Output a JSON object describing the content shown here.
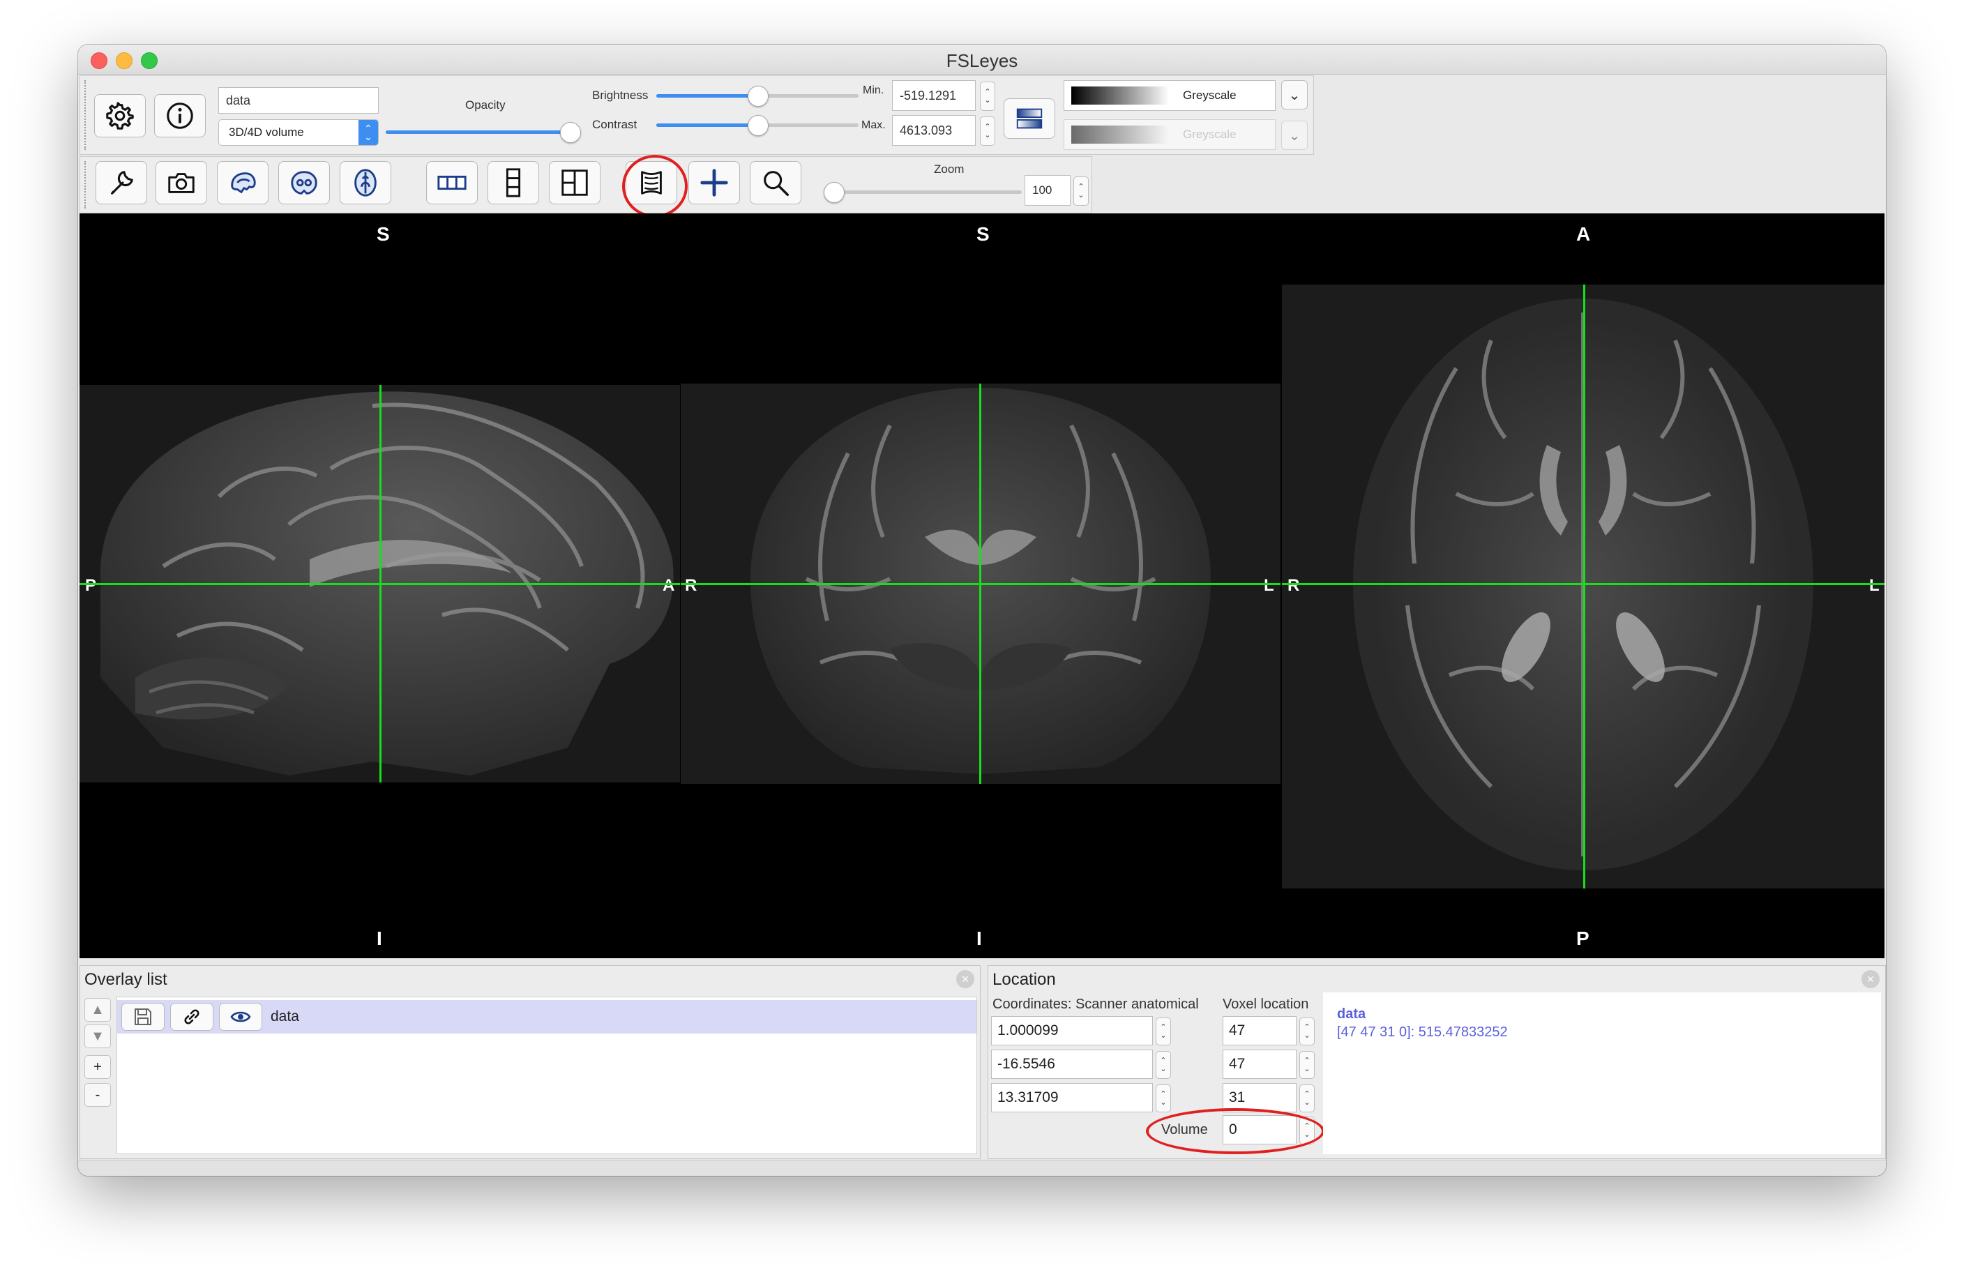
{
  "window": {
    "title": "FSLeyes"
  },
  "overlay_toolbar": {
    "overlay_name": "data",
    "overlay_type": "3D/4D volume",
    "opacity_label": "Opacity",
    "opacity_value": 1.0,
    "brightness_label": "Brightness",
    "brightness_value": 0.5,
    "contrast_label": "Contrast",
    "contrast_value": 0.5,
    "min_label": "Min.",
    "min_value": "-519.1291",
    "max_label": "Max.",
    "max_value": "4613.093",
    "colormap_primary": "Greyscale",
    "colormap_secondary": "Greyscale"
  },
  "ortho_toolbar": {
    "zoom_label": "Zoom",
    "zoom_value": "100",
    "zoom_slider_fraction": 0.0,
    "icons": [
      "wrench-icon",
      "camera-icon",
      "sagittal-icon",
      "coronal-icon",
      "axial-icon",
      "horizontal-layout-icon",
      "vertical-layout-icon",
      "grid-layout-icon",
      "movie-mode-icon",
      "cursor-crosshair-icon",
      "zoom-icon"
    ]
  },
  "views": {
    "sagittal": {
      "top": "S",
      "bottom": "I",
      "left": "P",
      "right": "A"
    },
    "coronal": {
      "top": "S",
      "bottom": "I",
      "left": "R",
      "right": "L"
    },
    "axial": {
      "top": "A",
      "bottom": "P",
      "left": "R",
      "right": "L"
    }
  },
  "overlay_list": {
    "title": "Overlay list",
    "items": [
      {
        "name": "data",
        "visible": true
      }
    ],
    "add_label": "+",
    "remove_label": "-"
  },
  "location": {
    "title": "Location",
    "coords_header": "Coordinates: Scanner anatomical",
    "voxel_header": "Voxel location",
    "coords": [
      "1.000099",
      "-16.5546",
      "13.31709"
    ],
    "voxels": [
      "47",
      "47",
      "31"
    ],
    "volume_label": "Volume",
    "volume_value": "0",
    "info_name": "data",
    "info_value": "[47 47 31 0]: 515.47833252"
  },
  "colors": {
    "accent": "#3d8ef0",
    "crosshair": "#18e018",
    "highlight": "#e02020",
    "selection": "#d8d9f6",
    "info_text": "#5a5fdc"
  }
}
